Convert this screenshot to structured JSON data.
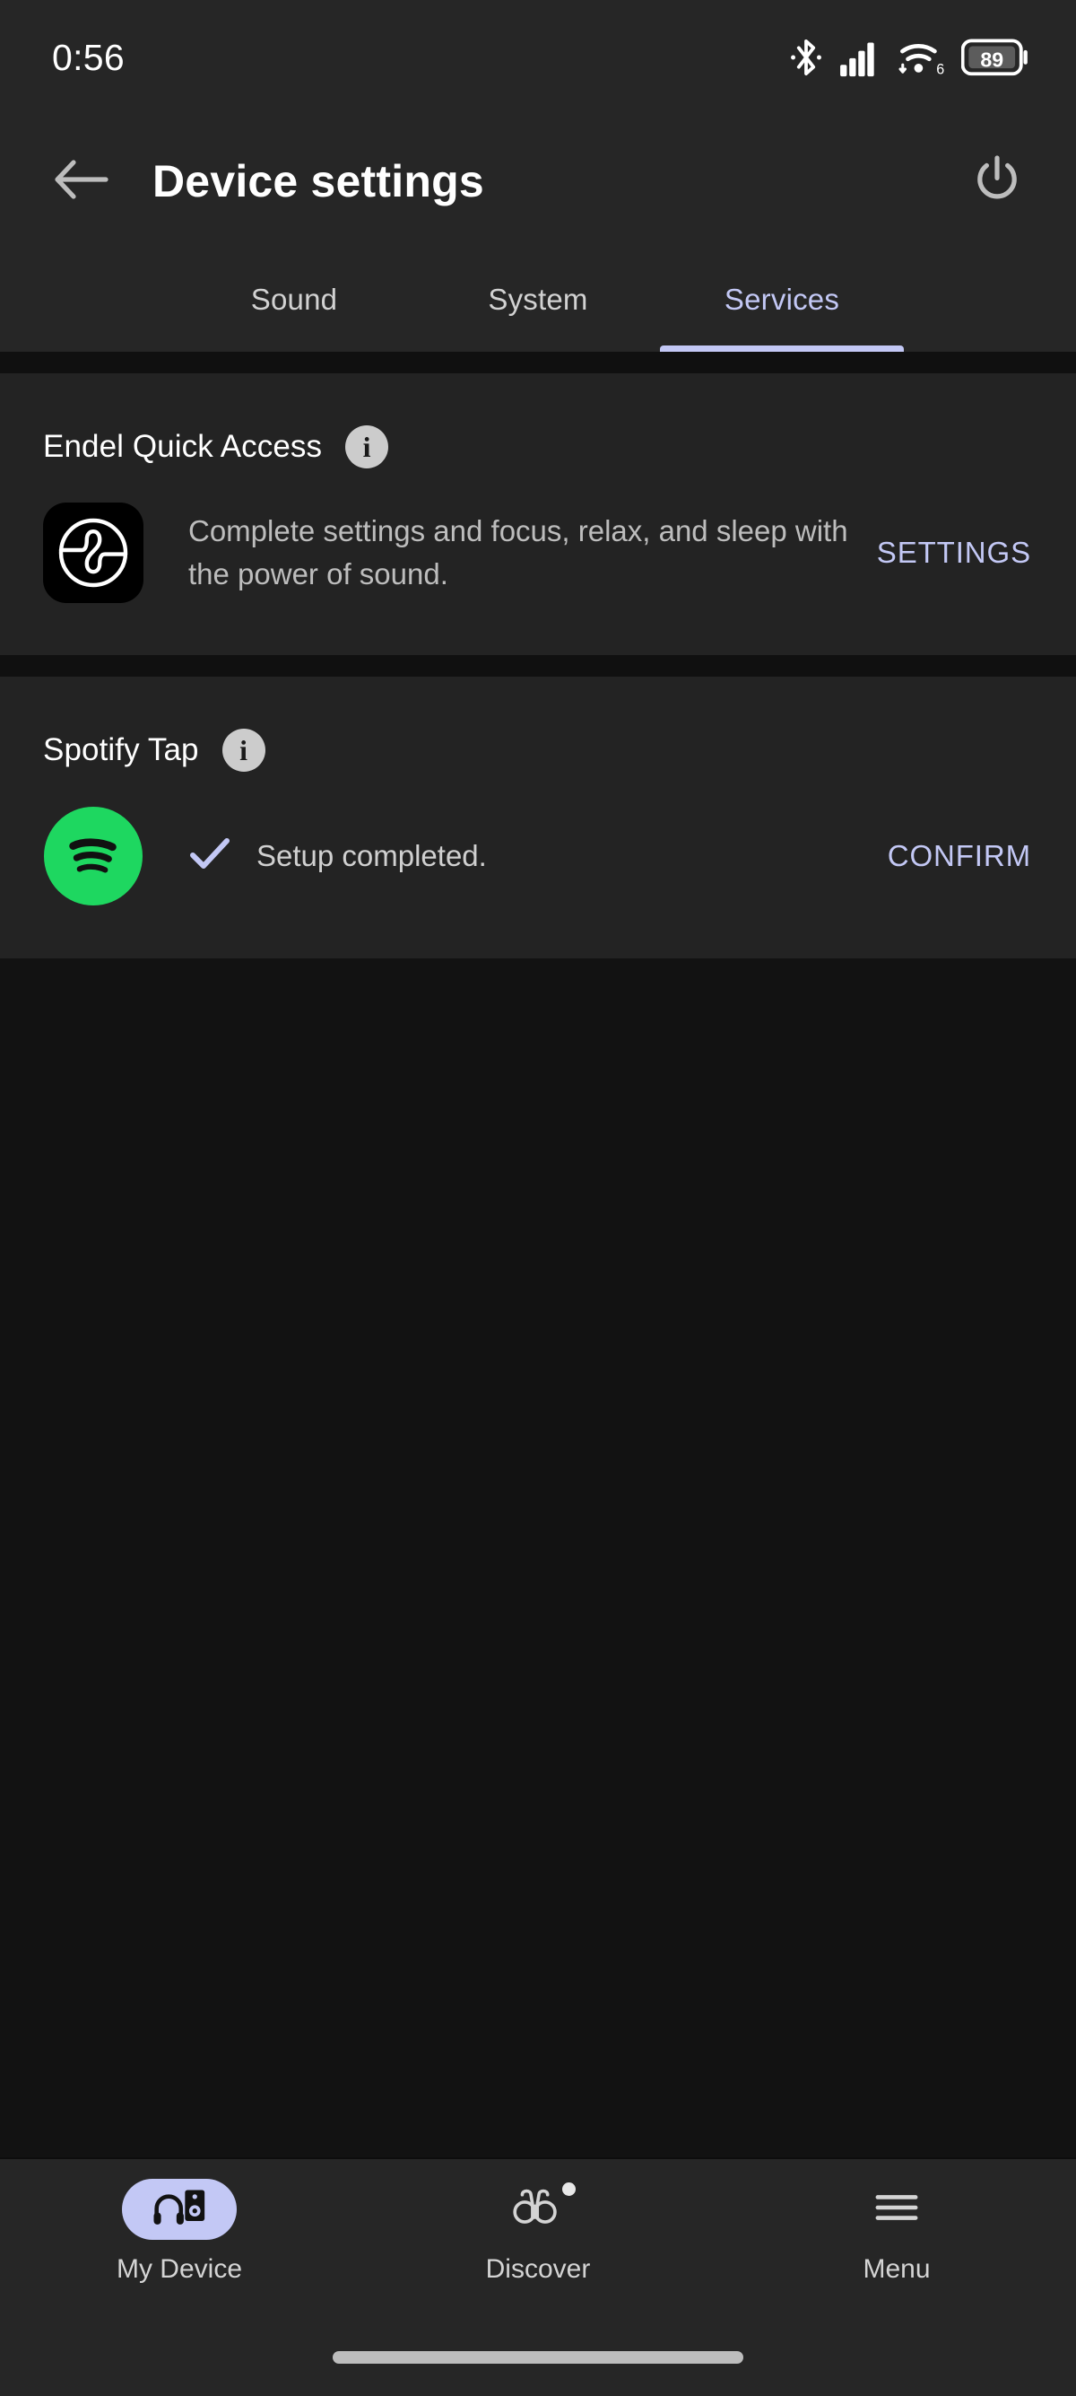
{
  "status_bar": {
    "clock": "0:56",
    "battery_level": "89",
    "icons": [
      "bluetooth-icon",
      "cellular-signal-icon",
      "wifi-6-icon",
      "battery-icon"
    ],
    "wifi_generation": "6"
  },
  "app_bar": {
    "back_icon": "arrow-left-icon",
    "title": "Device settings",
    "power_icon": "power-icon"
  },
  "tabs": [
    {
      "label": "Sound",
      "active": false
    },
    {
      "label": "System",
      "active": false
    },
    {
      "label": "Services",
      "active": true
    }
  ],
  "sections": [
    {
      "title": "Endel Quick Access",
      "info_icon": "info-icon",
      "service_icon": "endel-logo-icon",
      "description": "Complete settings and focus, relax, and sleep with the power of sound.",
      "action_label": "SETTINGS"
    },
    {
      "title": "Spotify Tap",
      "info_icon": "info-icon",
      "service_icon": "spotify-logo-icon",
      "status_icon": "check-icon",
      "status_text": "Setup completed.",
      "action_label": "CONFIRM"
    }
  ],
  "bottom_nav": [
    {
      "label": "My Device",
      "icon": "headphones-speaker-icon",
      "active": true,
      "badge": false
    },
    {
      "label": "Discover",
      "icon": "binoculars-icon",
      "active": false,
      "badge": true
    },
    {
      "label": "Menu",
      "icon": "hamburger-menu-icon",
      "active": false,
      "badge": false
    }
  ],
  "colors": {
    "accent": "#c3c8f5",
    "spotify_green": "#1ed760",
    "surface": "#232323",
    "app_bar": "#262626",
    "background": "#121212"
  }
}
